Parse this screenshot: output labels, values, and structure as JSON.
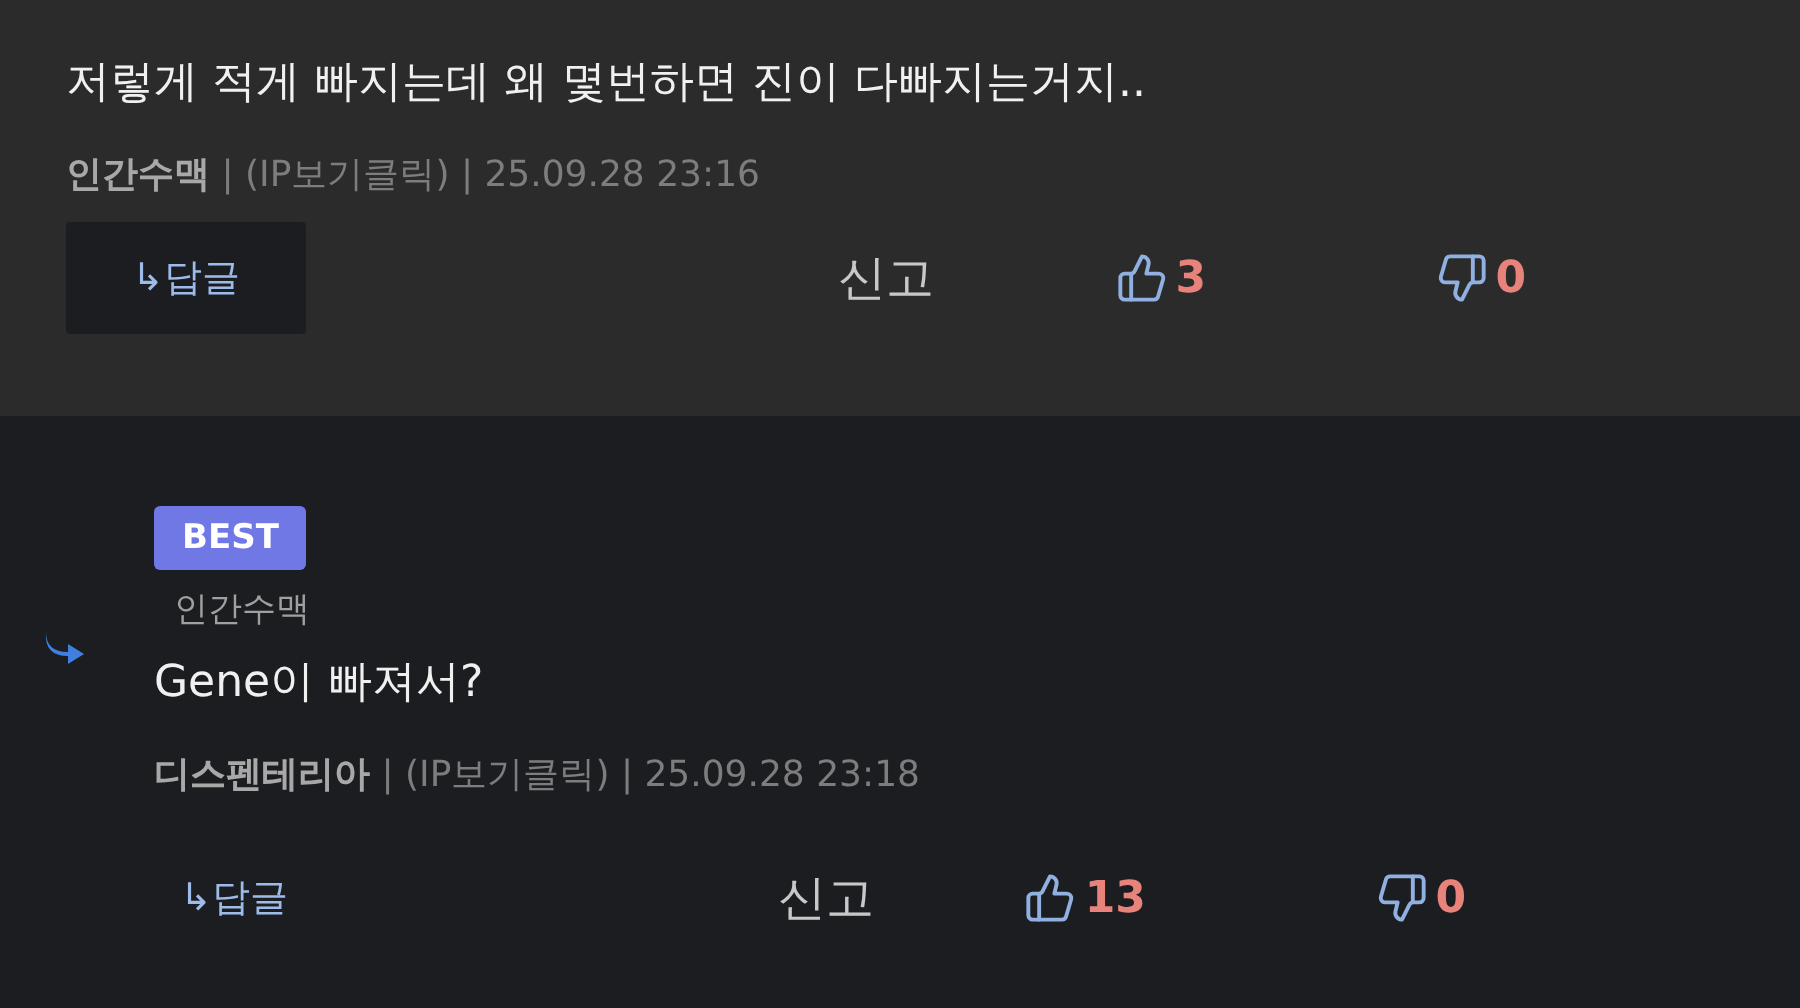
{
  "comments": [
    {
      "kind": "comment",
      "body": "저렇게 적게 빠지는데 왜 몇번하면 진이 다빠지는거지..",
      "meta": "**인간수맥** | (IP보기클릭) | 25.09.28 23:16",
      "reply": "↳답글",
      "report": "신고",
      "likes": "3",
      "dislikes": "0"
    },
    {
      "kind": "reply",
      "badge": "BEST",
      "reply_to": "인간수맥",
      "body": "Gene이 빠져서?",
      "meta": "**디스펜테리아** | (IP보기클릭) | 25.09.28 23:18",
      "reply": "↳답글",
      "report": "신고",
      "likes": "13",
      "dislikes": "0"
    }
  ]
}
